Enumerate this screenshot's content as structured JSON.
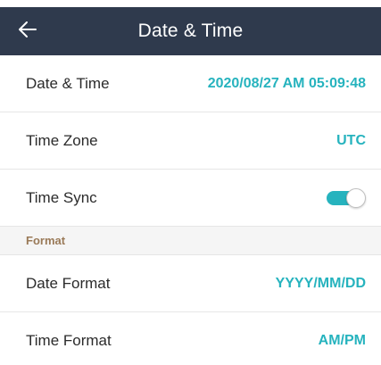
{
  "header": {
    "title": "Date & Time",
    "back_icon": "arrow-left-icon",
    "background": "#2f3a4d"
  },
  "rows": [
    {
      "label": "Date & Time",
      "value": "2020/08/27 AM 05:09:48"
    },
    {
      "label": "Time Zone",
      "value": "UTC"
    },
    {
      "label": "Time Sync",
      "toggle_on": true
    }
  ],
  "section": {
    "title": "Format"
  },
  "format_rows": [
    {
      "label": "Date Format",
      "value": "YYYY/MM/DD"
    },
    {
      "label": "Time Format",
      "value": "AM/PM"
    }
  ],
  "colors": {
    "accent": "#26b3be",
    "section_label": "#9a7a58",
    "header_bg": "#2f3a4d"
  }
}
